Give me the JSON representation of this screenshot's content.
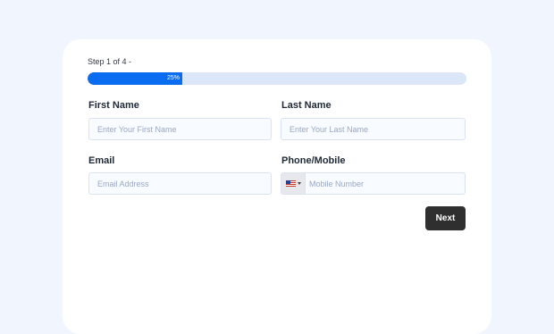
{
  "form": {
    "step_text": "Step 1 of 4 -",
    "progress": {
      "percent": 25,
      "label": "25%"
    },
    "first_name": {
      "label": "First Name",
      "placeholder": "Enter Your First Name",
      "value": ""
    },
    "last_name": {
      "label": "Last Name",
      "placeholder": "Enter Your Last Name",
      "value": ""
    },
    "email": {
      "label": "Email",
      "placeholder": "Email Address",
      "value": ""
    },
    "phone": {
      "label": "Phone/Mobile",
      "placeholder": "Mobile Number",
      "value": "",
      "country_icon": "us-flag-icon"
    },
    "next_label": "Next"
  },
  "colors": {
    "background": "#f1f5fd",
    "accent": "#0a6cf0",
    "progress_track": "#dbe6f9",
    "button": "#2f2f2f"
  }
}
